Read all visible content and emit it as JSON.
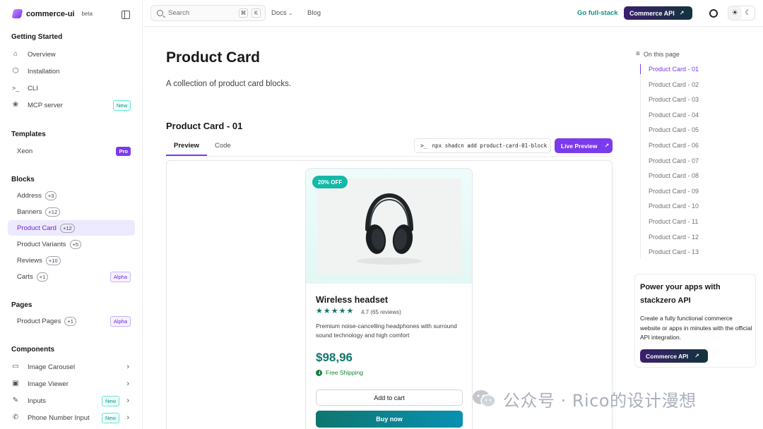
{
  "brand": {
    "name": "commerce-ui",
    "tag": "beta"
  },
  "sidebar": {
    "sections": {
      "getting_started": "Getting Started",
      "templates": "Templates",
      "blocks": "Blocks",
      "pages": "Pages",
      "components": "Components"
    },
    "getting_started_items": [
      {
        "label": "Overview",
        "icon": "home-icon"
      },
      {
        "label": "Installation",
        "icon": "package-icon"
      },
      {
        "label": "CLI",
        "icon": "terminal-icon"
      },
      {
        "label": "MCP server",
        "icon": "mcp-icon",
        "badge": "New"
      }
    ],
    "templates_items": [
      {
        "label": "Xeon",
        "badge": "Pro"
      }
    ],
    "blocks_items": [
      {
        "label": "Address",
        "count": "+3"
      },
      {
        "label": "Banners",
        "count": "+12"
      },
      {
        "label": "Product Card",
        "count": "+12",
        "active": true
      },
      {
        "label": "Product Variants",
        "count": "+5"
      },
      {
        "label": "Reviews",
        "count": "+10"
      },
      {
        "label": "Carts",
        "count": "+1",
        "badge": "Alpha"
      }
    ],
    "pages_items": [
      {
        "label": "Product Pages",
        "count": "+1",
        "badge": "Alpha"
      }
    ],
    "components_items": [
      {
        "label": "Image Carousel",
        "icon": "image-carousel-icon"
      },
      {
        "label": "Image Viewer",
        "icon": "image-icon"
      },
      {
        "label": "Inputs",
        "icon": "pencil-icon",
        "badge": "New"
      },
      {
        "label": "Phone Number Input",
        "icon": "phone-icon",
        "badge": "New"
      }
    ]
  },
  "header": {
    "search_placeholder": "Search",
    "shortcut_keys": [
      "⌘",
      "K"
    ],
    "docs_label": "Docs",
    "blog_label": "Blog",
    "go_full_stack": "Go full-stack",
    "commerce_api": "Commerce API"
  },
  "main": {
    "title": "Product Card",
    "description": "A collection of product card blocks.",
    "block_title": "Product Card - 01",
    "tabs": [
      "Preview",
      "Code"
    ],
    "command": "npx shadcn add product-card-01-block",
    "live_preview": "Live Preview"
  },
  "product": {
    "discount": "20% OFF",
    "name": "Wireless headset",
    "rating_stars": 5,
    "rating_text": "4.7 (65 reviews)",
    "description": "Premium noise-cancelling headphones with surround sound technology and high comfort",
    "price": "$98,96",
    "shipping": "Free Shipping",
    "add_to_cart": "Add to cart",
    "buy_now": "Buy now"
  },
  "toc": {
    "heading": "On this page",
    "items": [
      "Product Card - 01",
      "Product Card - 02",
      "Product Card - 03",
      "Product Card - 04",
      "Product Card - 05",
      "Product Card - 06",
      "Product Card - 07",
      "Product Card - 08",
      "Product Card - 09",
      "Product Card - 10",
      "Product Card - 11",
      "Product Card - 12",
      "Product Card - 13"
    ],
    "active_index": 0
  },
  "promo": {
    "title": "Power your apps with stackzero API",
    "text": "Create a fully functional commerce website or apps in minutes with the official API integration.",
    "button": "Commerce API"
  },
  "watermark": {
    "text": "公众号 · Rico的设计漫想"
  },
  "colors": {
    "accent": "#7c3aed",
    "teal": "#0f766e",
    "active_bg": "#ede9fe",
    "dark_button": "#3b1f6e"
  }
}
